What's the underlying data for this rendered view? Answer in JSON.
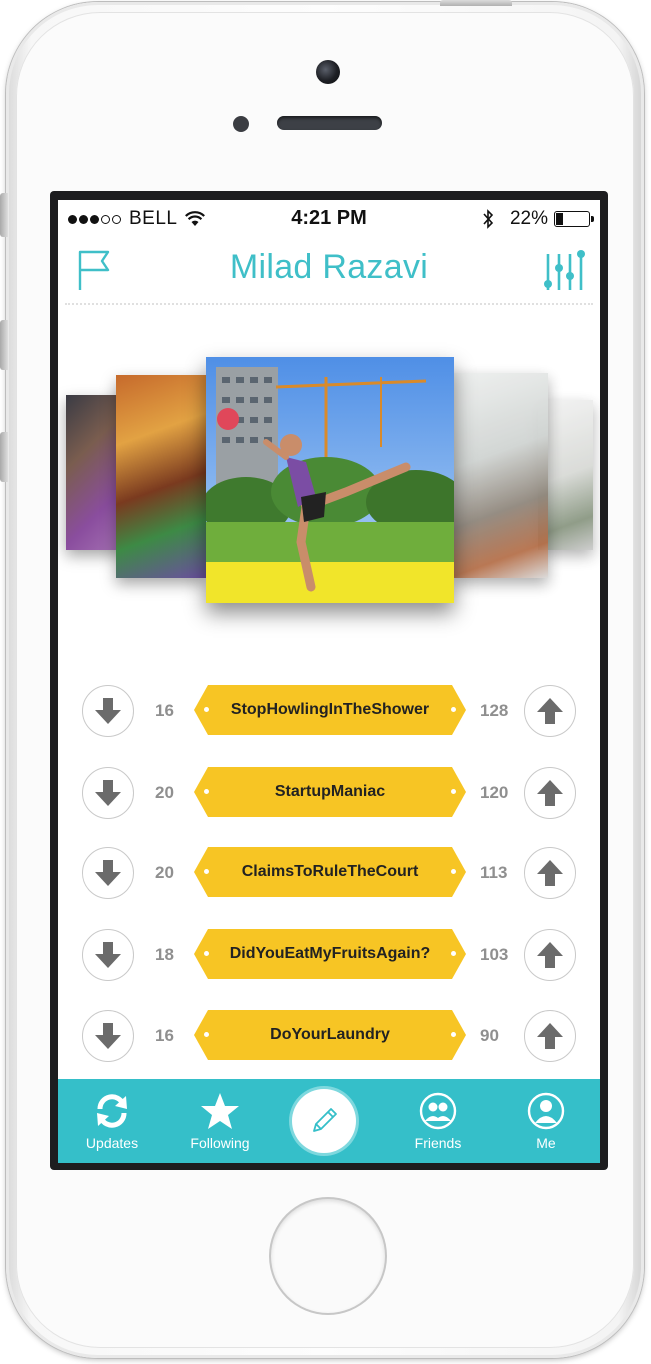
{
  "status_bar": {
    "carrier": "BELL",
    "time": "4:21 PM",
    "battery": "22%"
  },
  "header": {
    "title": "Milad Razavi",
    "left_icon": "flag-icon",
    "right_icon": "sliders-icon"
  },
  "carousel": {
    "photo_count": 5,
    "selected_index": 2
  },
  "tags": [
    {
      "label": "StopHowlingInTheShower",
      "down": "16",
      "up": "128"
    },
    {
      "label": "StartupManiac",
      "down": "20",
      "up": "120"
    },
    {
      "label": "ClaimsToRuleTheCourt",
      "down": "20",
      "up": "113"
    },
    {
      "label": "DidYouEatMyFruitsAgain?",
      "down": "18",
      "up": "103"
    },
    {
      "label": "DoYourLaundry",
      "down": "16",
      "up": "90"
    }
  ],
  "tabbar": {
    "updates": "Updates",
    "following": "Following",
    "friends": "Friends",
    "me": "Me",
    "compose_icon": "pencil-icon"
  },
  "colors": {
    "accent": "#35bfc9",
    "tag": "#f7c524",
    "count": "#8f8f8f"
  }
}
